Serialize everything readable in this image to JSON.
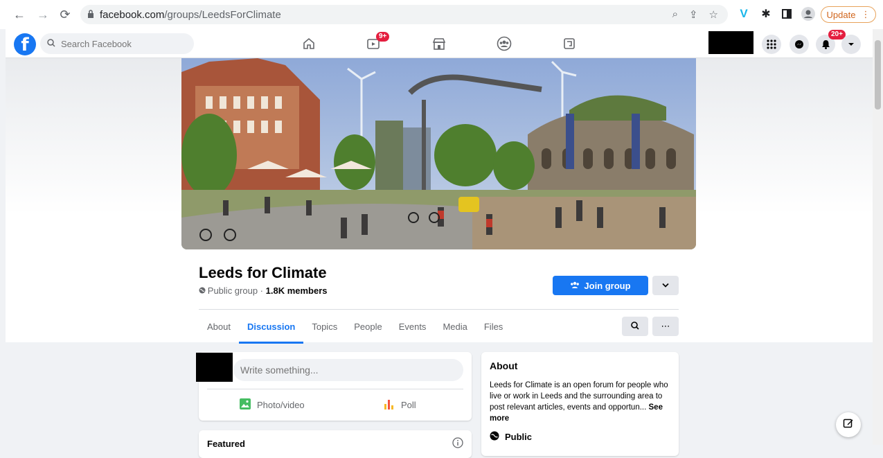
{
  "browser": {
    "url_domain": "facebook.com",
    "url_path": "/groups/LeedsForClimate",
    "update_label": "Update"
  },
  "fb": {
    "search_placeholder": "Search Facebook",
    "watch_badge": "9+",
    "notifications_badge": "20+"
  },
  "group": {
    "name": "Leeds for Climate",
    "privacy": "Public group",
    "separator": " · ",
    "members": "1.8K members",
    "join_label": "Join group"
  },
  "tabs": [
    "About",
    "Discussion",
    "Topics",
    "People",
    "Events",
    "Media",
    "Files"
  ],
  "active_tab": "Discussion",
  "composer": {
    "placeholder": "Write something...",
    "photo_label": "Photo/video",
    "poll_label": "Poll"
  },
  "featured": {
    "title": "Featured"
  },
  "about": {
    "title": "About",
    "text": "Leeds for Climate is an open forum for people who live or work in Leeds and the surrounding area to post relevant articles, events and opportun...",
    "see_more": "See more",
    "privacy_label": "Public"
  },
  "colors": {
    "fb_blue": "#1877f2",
    "badge_red": "#e41e3f",
    "update_orange": "#d0651c"
  }
}
